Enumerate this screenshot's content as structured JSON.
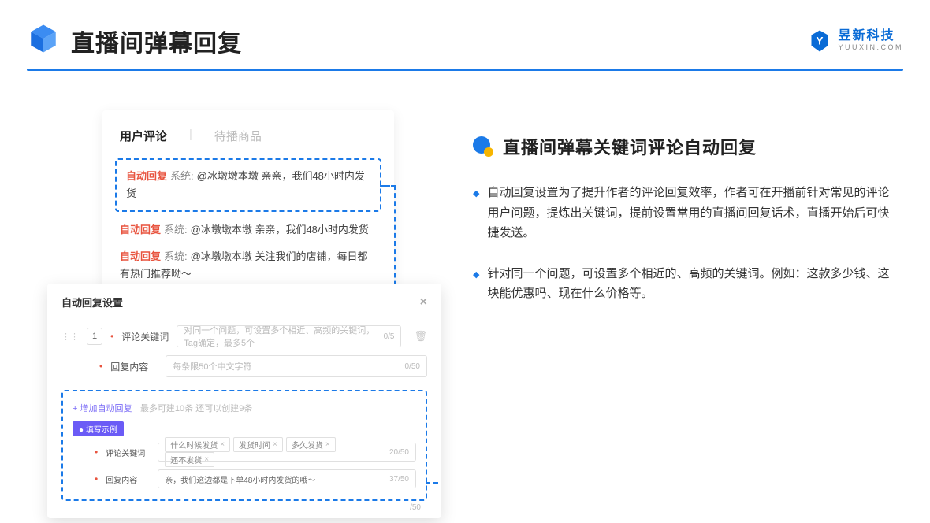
{
  "header": {
    "title": "直播间弹幕回复",
    "brand_cn": "昱新科技",
    "brand_en": "YUUXIN.COM"
  },
  "comments_card": {
    "tab_active": "用户评论",
    "tab_inactive": "待播商品",
    "items": [
      {
        "badge": "自动回复",
        "sys": "系统:",
        "text": "@冰墩墩本墩 亲亲，我们48小时内发货"
      },
      {
        "badge": "自动回复",
        "sys": "系统:",
        "text": "@冰墩墩本墩 亲亲，我们48小时内发货"
      },
      {
        "badge": "自动回复",
        "sys": "系统:",
        "text": "@冰墩墩本墩 关注我们的店铺，每日都有热门推荐呦～"
      }
    ]
  },
  "settings": {
    "title": "自动回复设置",
    "idx": "1",
    "kw_label": "评论关键词",
    "kw_placeholder": "对同一个问题，可设置多个相近、高频的关键词，Tag确定，最多5个",
    "kw_count": "0/5",
    "reply_label": "回复内容",
    "reply_placeholder": "每条限50个中文字符",
    "reply_count": "0/50",
    "add_link": "+ 增加自动回复",
    "add_hint": "最多可建10条 还可以创建9条",
    "example_pill": "● 填写示例",
    "ex_kw_label": "评论关键词",
    "ex_tags": [
      "什么时候发货",
      "发货时间",
      "多久发货",
      "还不发货"
    ],
    "ex_kw_count": "20/50",
    "ex_reply_label": "回复内容",
    "ex_reply_value": "亲，我们这边都是下单48小时内发货的哦～",
    "ex_reply_count": "37/50",
    "outer_count": "/50"
  },
  "right": {
    "section_title": "直播间弹幕关键词评论自动回复",
    "bullets": [
      "自动回复设置为了提升作者的评论回复效率，作者可在开播前针对常见的评论用户问题，提炼出关键词，提前设置常用的直播间回复话术，直播开始后可快捷发送。",
      "针对同一个问题，可设置多个相近的、高频的关键词。例如：这款多少钱、这块能优惠吗、现在什么价格等。"
    ]
  }
}
